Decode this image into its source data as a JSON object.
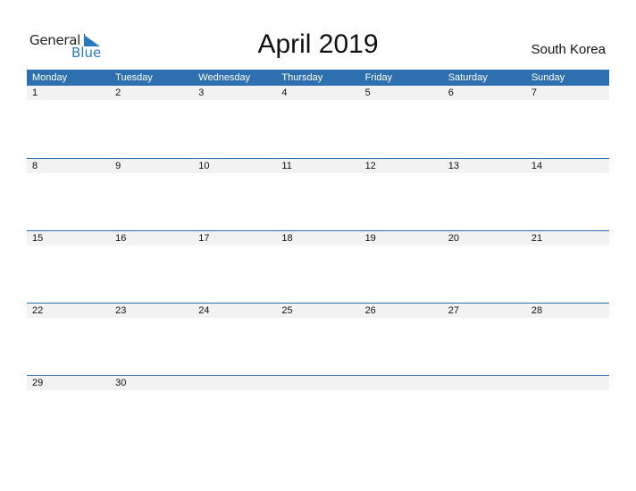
{
  "logo": {
    "general": "General",
    "blue": "Blue"
  },
  "title": "April 2019",
  "country": "South Korea",
  "weekdays": [
    "Monday",
    "Tuesday",
    "Wednesday",
    "Thursday",
    "Friday",
    "Saturday",
    "Sunday"
  ],
  "weeks": [
    [
      "1",
      "2",
      "3",
      "4",
      "5",
      "6",
      "7"
    ],
    [
      "8",
      "9",
      "10",
      "11",
      "12",
      "13",
      "14"
    ],
    [
      "15",
      "16",
      "17",
      "18",
      "19",
      "20",
      "21"
    ],
    [
      "22",
      "23",
      "24",
      "25",
      "26",
      "27",
      "28"
    ],
    [
      "29",
      "30",
      "",
      "",
      "",
      "",
      ""
    ]
  ],
  "colors": {
    "accent": "#2e6fb0",
    "logo_blue": "#2a7abf",
    "row_bg": "#f2f2f2"
  }
}
